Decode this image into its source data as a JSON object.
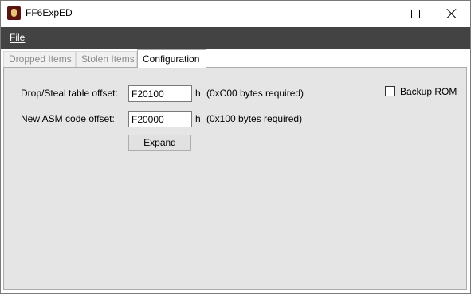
{
  "window": {
    "title": "FF6ExpED",
    "icon": "app-icon",
    "controls": {
      "minimize": "minimize-icon",
      "maximize": "maximize-icon",
      "close": "close-icon"
    }
  },
  "menu": {
    "items": [
      {
        "label": "File"
      }
    ]
  },
  "tabs": [
    {
      "label": "Dropped Items",
      "selected": false
    },
    {
      "label": "Stolen Items",
      "selected": false
    },
    {
      "label": "Configuration",
      "selected": true
    }
  ],
  "config": {
    "drop_steal": {
      "label": "Drop/Steal table offset:",
      "value": "F20100",
      "unit": "h",
      "note": "(0xC00 bytes required)"
    },
    "asm_code": {
      "label": "New ASM code offset:",
      "value": "F20000",
      "unit": "h",
      "note": "(0x100 bytes required)"
    },
    "expand_button": "Expand",
    "backup_rom": {
      "label": "Backup ROM",
      "checked": false
    }
  },
  "colors": {
    "menubar": "#434343",
    "panel": "#e5e5e5",
    "button": "#e1e1e1"
  }
}
